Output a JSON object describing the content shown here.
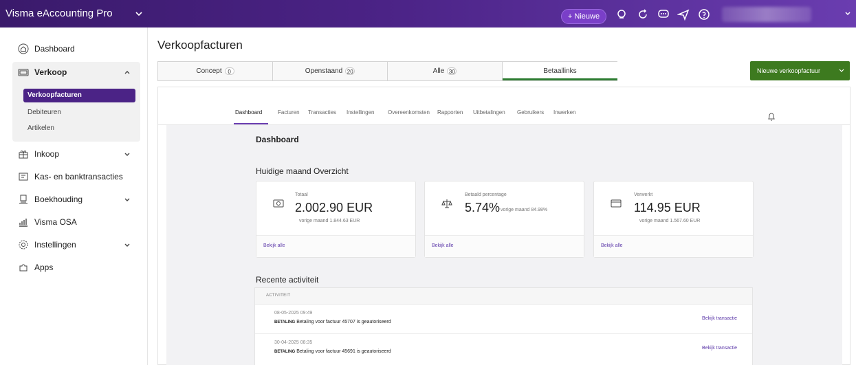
{
  "app": {
    "title": "Visma eAccounting Pro",
    "new_label": "+ Nieuwe"
  },
  "sidebar": {
    "dashboard": "Dashboard",
    "verkoop": "Verkoop",
    "verkoop_sub": [
      "Verkoopfacturen",
      "Debiteuren",
      "Artikelen"
    ],
    "inkoop": "Inkoop",
    "kas": "Kas- en banktransacties",
    "boekhouding": "Boekhouding",
    "osa": "Visma OSA",
    "instellingen": "Instellingen",
    "apps": "Apps"
  },
  "page": {
    "title": "Verkoopfacturen",
    "new_invoice_label": "Nieuwe verkoopfactuur"
  },
  "tabs": [
    {
      "label": "Concept",
      "count": "0"
    },
    {
      "label": "Openstaand",
      "count": "20"
    },
    {
      "label": "Alle",
      "count": "30"
    },
    {
      "label": "Betaallinks",
      "count": ""
    }
  ],
  "subnav": [
    "Dashboard",
    "Facturen",
    "Transacties",
    "Instellingen",
    "Overeenkomsten",
    "Rapporten",
    "Uitbetalingen",
    "Gebruikers",
    "Inwerken"
  ],
  "dashboard": {
    "heading": "Dashboard",
    "month_heading": "Huidige maand Overzicht",
    "cards": [
      {
        "label": "Totaal",
        "value": "2.002.90 EUR",
        "sub": "vorige maand 1.844.63 EUR",
        "link": "Bekijk alle"
      },
      {
        "label": "Betaald percentage",
        "value": "5.74%",
        "sub": "vorige maand 84.98%",
        "link": "Bekijk alle"
      },
      {
        "label": "Verwerkt",
        "value": "114.95 EUR",
        "sub": "vorige maand 1.567.60 EUR",
        "link": "Bekijk alle"
      }
    ],
    "recent_heading": "Recente activiteit",
    "activity_header": "ACTIVITEIT",
    "activities": [
      {
        "time": "08-05-2025 09:49",
        "tag": "BETALING",
        "text": "Betaling voor factuur 45707 is geautoriseerd",
        "link": "Bekijk transactie"
      },
      {
        "time": "30-04-2025 08:35",
        "tag": "BETALING",
        "text": "Betaling voor factuur 45691 is geautoriseerd",
        "link": "Bekijk transactie"
      }
    ]
  }
}
